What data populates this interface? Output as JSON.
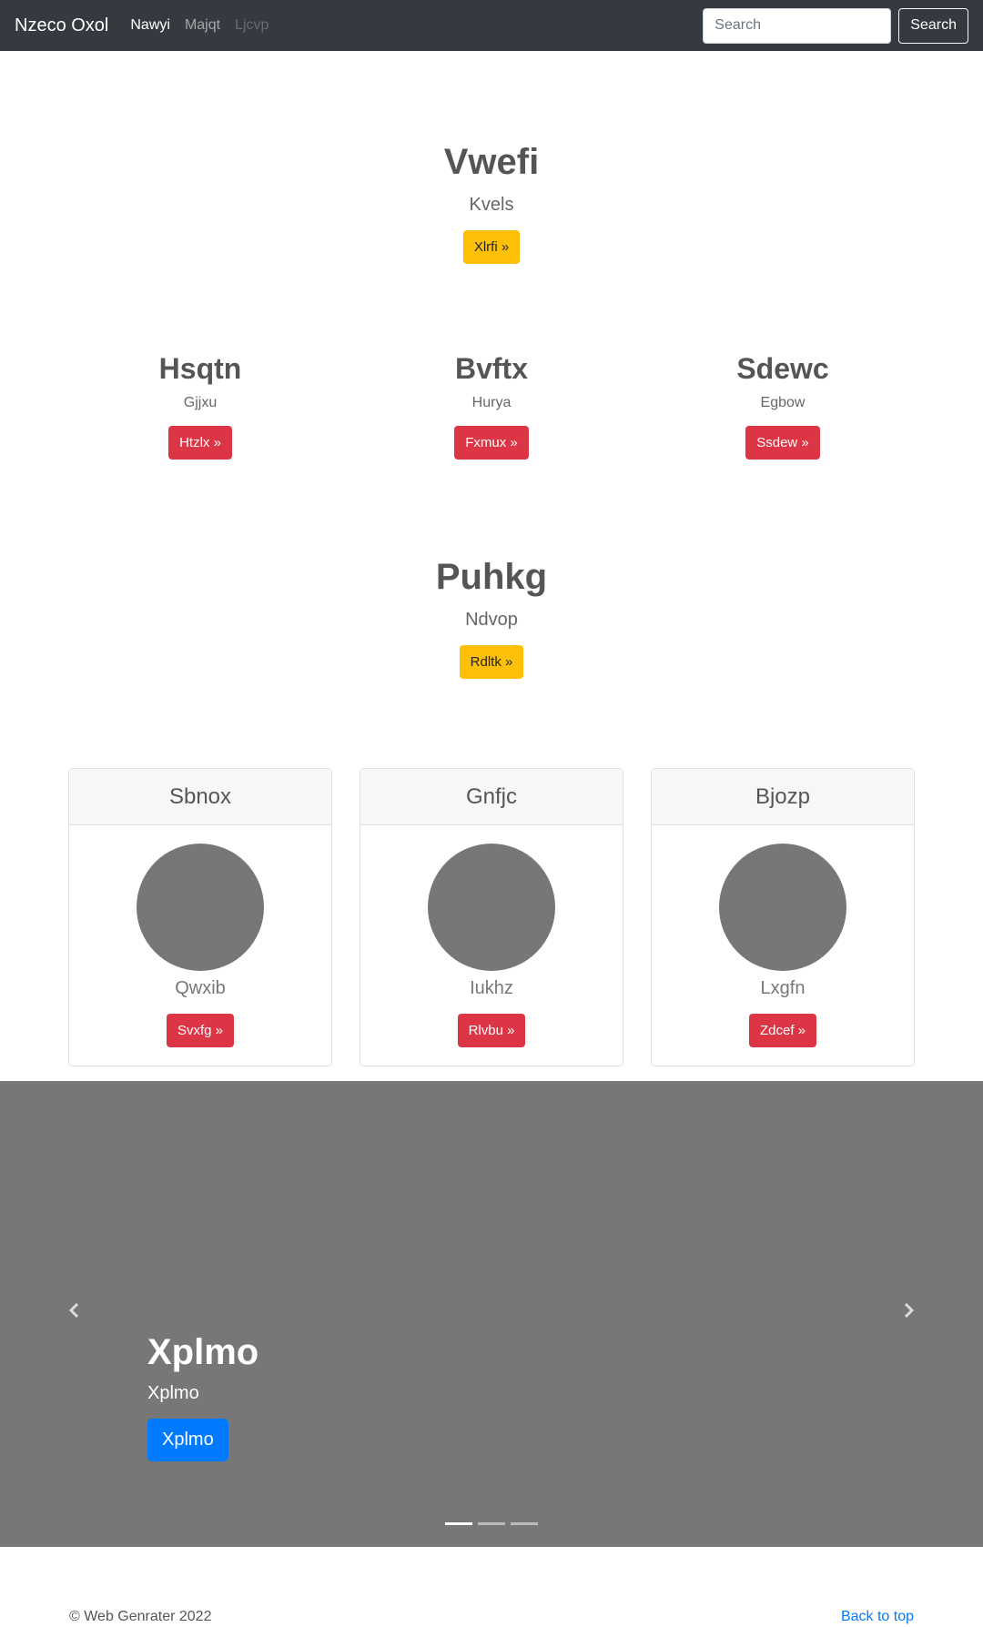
{
  "navbar": {
    "brand": "Nzeco Oxol",
    "links": [
      "Nawyi",
      "Majqt",
      "Ljcvp"
    ],
    "search_placeholder": "Search",
    "search_button": "Search"
  },
  "hero1": {
    "title": "Vwefi",
    "lead": "Kvels",
    "button": "Xlrfi »"
  },
  "columns": [
    {
      "title": "Hsqtn",
      "text": "Gjjxu",
      "button": "Htzlx »"
    },
    {
      "title": "Bvftx",
      "text": "Hurya",
      "button": "Fxmux »"
    },
    {
      "title": "Sdewc",
      "text": "Egbow",
      "button": "Ssdew »"
    }
  ],
  "hero2": {
    "title": "Puhkg",
    "lead": "Ndvop",
    "button": "Rdltk »"
  },
  "cards": [
    {
      "header": "Sbnox",
      "text": "Qwxib",
      "button": "Svxfg »"
    },
    {
      "header": "Gnfjc",
      "text": "Iukhz",
      "button": "Rlvbu »"
    },
    {
      "header": "Bjozp",
      "text": "Lxgfn",
      "button": "Zdcef »"
    }
  ],
  "carousel": {
    "title": "Xplmo",
    "subtitle": "Xplmo",
    "button": "Xplmo",
    "prev_icon": "chevron-left-icon",
    "next_icon": "chevron-right-icon",
    "active_slide": 1,
    "slide_count": 3
  },
  "footer": {
    "copyright": "© Web Genrater 2022",
    "back_to_top": "Back to top"
  }
}
